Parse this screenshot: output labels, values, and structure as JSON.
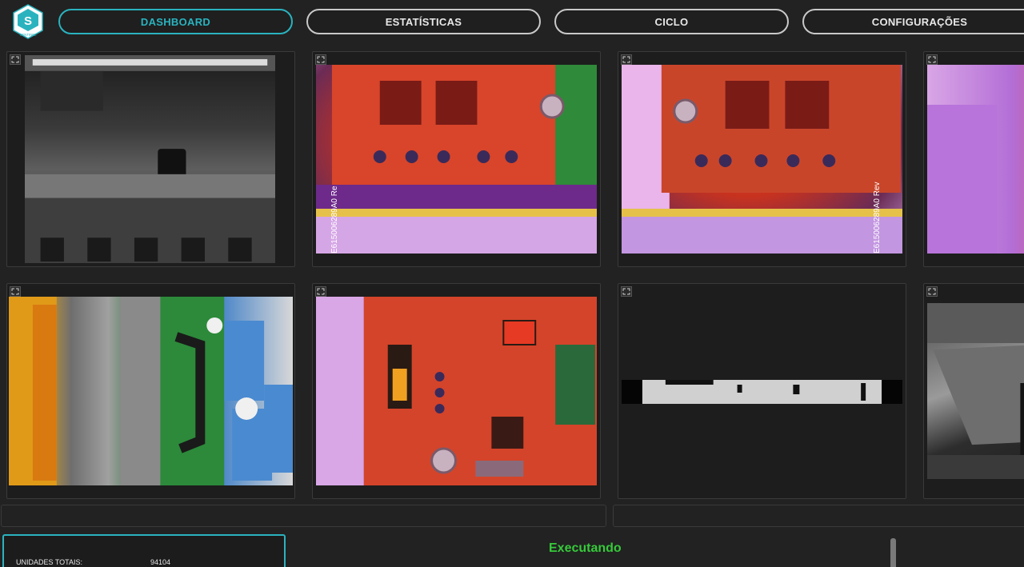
{
  "app": {
    "logo_text": "SENTINEL"
  },
  "nav": {
    "tabs": [
      {
        "label": "DASHBOARD",
        "active": true
      },
      {
        "label": "ESTATÍSTICAS",
        "active": false
      },
      {
        "label": "CICLO",
        "active": false
      },
      {
        "label": "CONFIGURAÇÕES",
        "active": false
      }
    ]
  },
  "cameras": [
    {
      "id": "cam-1",
      "label": "E615006289A0 Re"
    },
    {
      "id": "cam-2",
      "label": "E615006289A0 Re"
    },
    {
      "id": "cam-3",
      "label": "E615006289A0 Rev"
    },
    {
      "id": "cam-4",
      "label": ""
    },
    {
      "id": "cam-5",
      "label": ""
    },
    {
      "id": "cam-6",
      "label": ""
    },
    {
      "id": "cam-7",
      "label": ""
    },
    {
      "id": "cam-8",
      "label": ""
    }
  ],
  "stats": {
    "total_units_label": "UNIDADES TOTAIS:",
    "total_units_value": "94104"
  },
  "status": {
    "text": "Executando",
    "color": "#36c93a"
  },
  "colors": {
    "accent": "#2ab3bf",
    "background": "#222222"
  }
}
